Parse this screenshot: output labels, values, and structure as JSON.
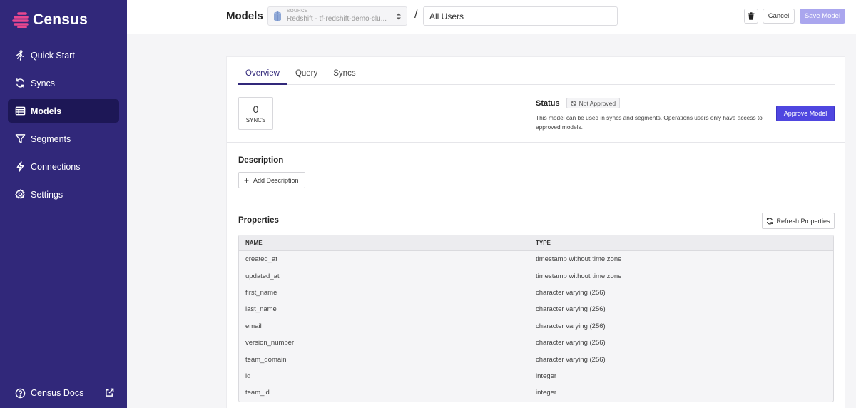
{
  "brand": {
    "name": "Census",
    "logo_color": "#e8478f"
  },
  "sidebar": {
    "items": [
      {
        "label": "Quick Start",
        "icon": "runner-icon"
      },
      {
        "label": "Syncs",
        "icon": "sync-icon"
      },
      {
        "label": "Models",
        "icon": "table-icon",
        "active": true
      },
      {
        "label": "Segments",
        "icon": "filter-icon"
      },
      {
        "label": "Connections",
        "icon": "bolt-icon"
      },
      {
        "label": "Settings",
        "icon": "gear-icon"
      }
    ],
    "docs_label": "Census Docs"
  },
  "topbar": {
    "title": "Models",
    "source_label": "SOURCE",
    "source_value": "Redshift - tf-redshift-demo-clu...",
    "slash": "/",
    "model_name": "All Users",
    "cancel_label": "Cancel",
    "save_label": "Save Model"
  },
  "tabs": [
    "Overview",
    "Query",
    "Syncs"
  ],
  "overview": {
    "syncs_count": "0",
    "syncs_label": "SYNCS",
    "status_label": "Status",
    "status_badge": "Not Approved",
    "status_description": "This model can be used in syncs and segments. Operations users only have access to approved models.",
    "approve_label": "Approve Model"
  },
  "description": {
    "title": "Description",
    "add_label": "Add Description"
  },
  "properties": {
    "title": "Properties",
    "refresh_label": "Refresh Properties",
    "columns": [
      "NAME",
      "TYPE"
    ],
    "rows": [
      {
        "name": "created_at",
        "type": "timestamp without time zone"
      },
      {
        "name": "updated_at",
        "type": "timestamp without time zone"
      },
      {
        "name": "first_name",
        "type": "character varying (256)"
      },
      {
        "name": "last_name",
        "type": "character varying (256)"
      },
      {
        "name": "email",
        "type": "character varying (256)"
      },
      {
        "name": "version_number",
        "type": "character varying (256)"
      },
      {
        "name": "team_domain",
        "type": "character varying (256)"
      },
      {
        "name": "id",
        "type": "integer"
      },
      {
        "name": "team_id",
        "type": "integer"
      }
    ]
  },
  "colors": {
    "sidebar_bg": "#31287a",
    "sidebar_active": "#1d1756",
    "primary_button": "#4f46e0",
    "save_button_disabled": "#aaa6ee"
  }
}
